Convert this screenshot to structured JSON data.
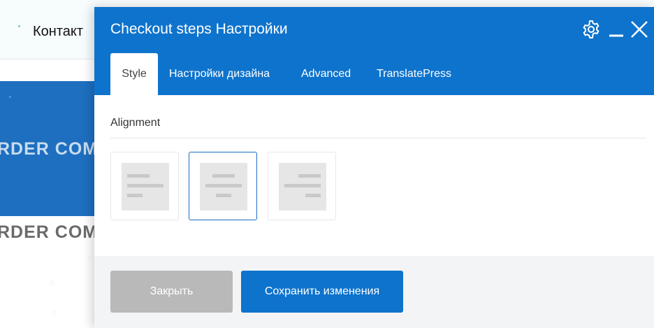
{
  "background": {
    "contacts_label": "Контакт",
    "hero_text": "RDER COM",
    "heading_text": "RDER COMP"
  },
  "modal": {
    "title": "Checkout steps Настройки",
    "header_icons": [
      "gear-icon",
      "minimize-icon",
      "close-icon"
    ],
    "tabs": [
      {
        "label": "Style",
        "active": true
      },
      {
        "label": "Настройки дизайна",
        "active": false
      },
      {
        "label": "Advanced",
        "active": false
      },
      {
        "label": "TranslatePress",
        "active": false
      }
    ],
    "section": {
      "label": "Alignment",
      "options": [
        {
          "name": "left",
          "selected": false
        },
        {
          "name": "center",
          "selected": true
        },
        {
          "name": "right",
          "selected": false
        }
      ]
    },
    "footer": {
      "close_label": "Закрыть",
      "save_label": "Сохранить изменения"
    }
  },
  "colors": {
    "accent": "#0e73cc",
    "selected_border": "#1a6fc5",
    "disabled_button": "#b9b9b9",
    "hero_bg": "#1e6fc0"
  }
}
